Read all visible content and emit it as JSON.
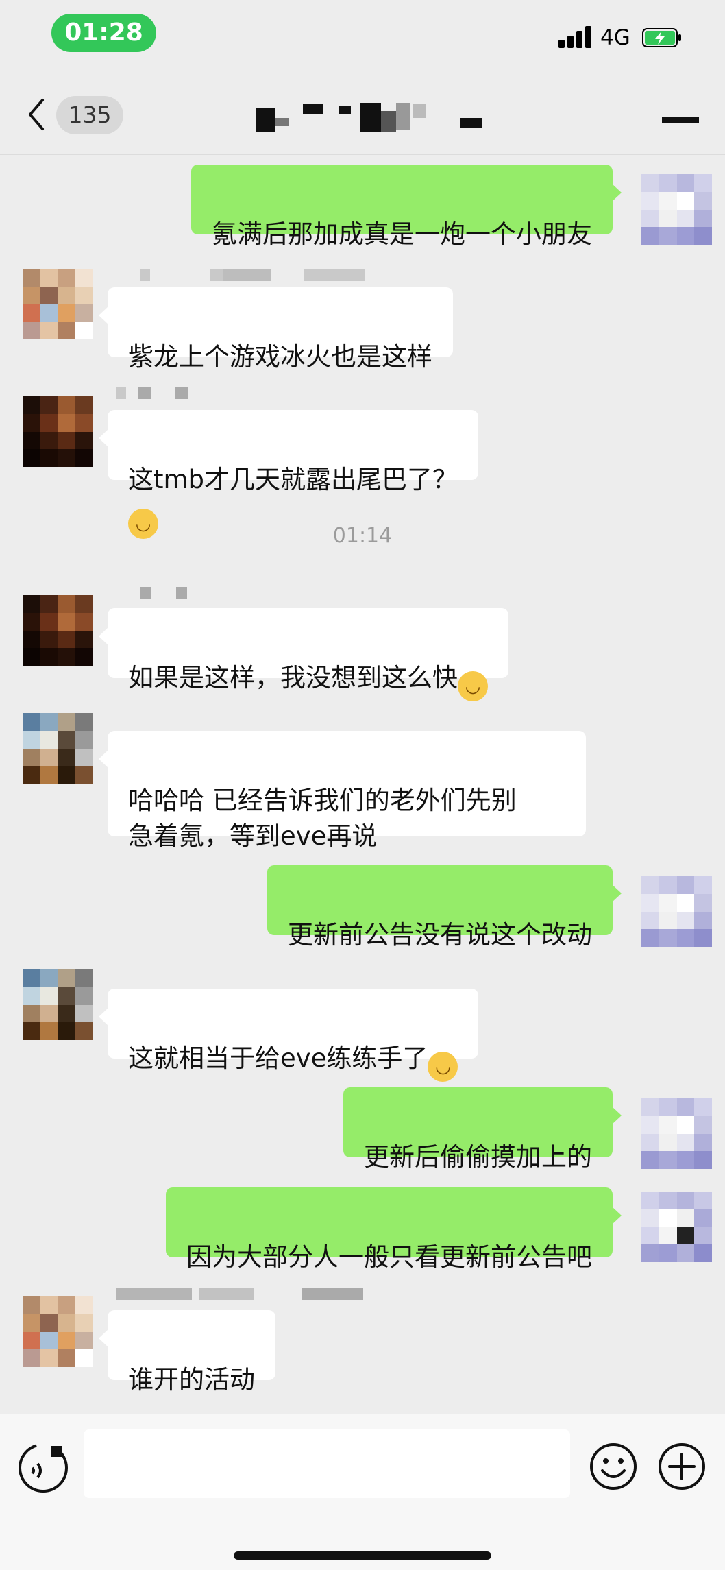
{
  "status_bar": {
    "time": "01:28",
    "network": "4G",
    "signal_icon": "signal-bars-icon",
    "battery_icon": "battery-charging-icon",
    "accent_color": "#33c759"
  },
  "nav": {
    "unread_count": "135",
    "back_icon": "chevron-left-icon",
    "more_icon": "more-dots-icon"
  },
  "colors": {
    "outgoing_bubble": "#95ec69",
    "incoming_bubble": "#ffffff",
    "chat_background": "#ededed"
  },
  "messages": [
    {
      "direction": "out",
      "text": "氪满后那加成真是一炮一个小朋友"
    },
    {
      "direction": "in",
      "text": "紫龙上个游戏冰火也是这样"
    },
    {
      "direction": "in",
      "text": "这tmb才几天就露出尾巴了？",
      "emoji": "crying-laughing-emoji"
    },
    {
      "direction": "in",
      "text": "如果是这样，我没想到这么快",
      "emoji": "tears-of-joy-emoji"
    },
    {
      "direction": "in",
      "text": "哈哈哈 已经告诉我们的老外们先别\n急着氪，等到eve再说"
    },
    {
      "direction": "out",
      "text": "更新前公告没有说这个改动"
    },
    {
      "direction": "in",
      "text": "这就相当于给eve练练手了",
      "emoji": "tears-of-joy-emoji"
    },
    {
      "direction": "out",
      "text": "更新后偷偷摸加上的"
    },
    {
      "direction": "out",
      "text": "因为大部分人一般只看更新前公告吧"
    },
    {
      "direction": "in",
      "text": "谁开的活动"
    }
  ],
  "timestamp": "01:14",
  "input": {
    "value": "",
    "voice_icon": "voice-icon",
    "emoji_icon": "emoji-smile-icon",
    "add_icon": "plus-circle-icon"
  }
}
